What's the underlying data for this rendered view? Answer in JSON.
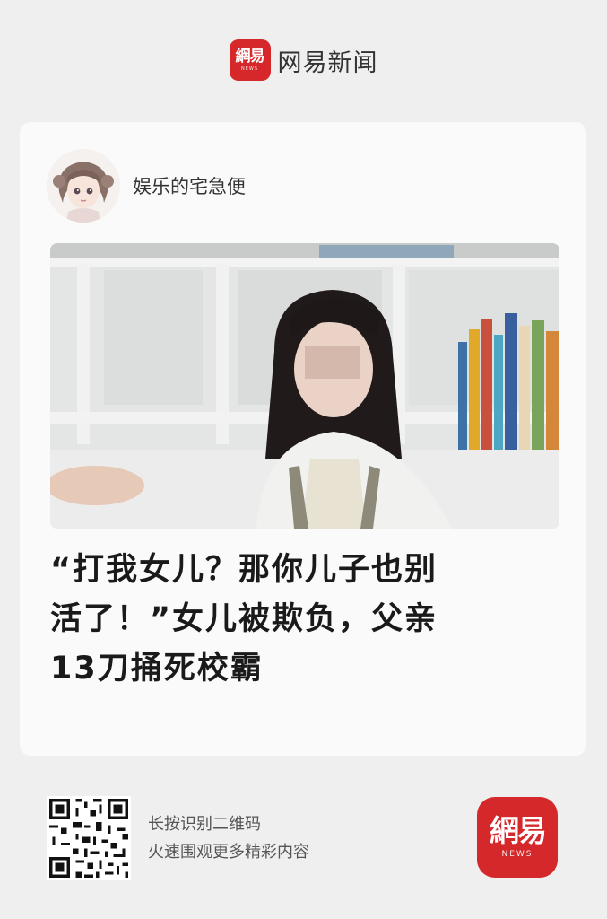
{
  "header": {
    "logo": {
      "glyphs": "網易",
      "sub": "NEWS",
      "color": "#d6282a"
    },
    "app_name": "网易新闻"
  },
  "article": {
    "author": {
      "name": "娱乐的宅急便",
      "avatar_icon": "anime-girl-avatar"
    },
    "photo_icon": "girl-in-classroom-photo",
    "headline_lines": [
      "“打我女儿？那你儿子也别",
      "活了！”女儿被欺负，父亲",
      "13刀捅死校霸"
    ]
  },
  "footer": {
    "qr_icon": "qr-code-icon",
    "qr_line1": "长按识别二维码",
    "qr_line2": "火速围观更多精彩内容",
    "logo": {
      "glyphs": "網易",
      "sub": "NEWS",
      "color": "#d5282b"
    }
  }
}
